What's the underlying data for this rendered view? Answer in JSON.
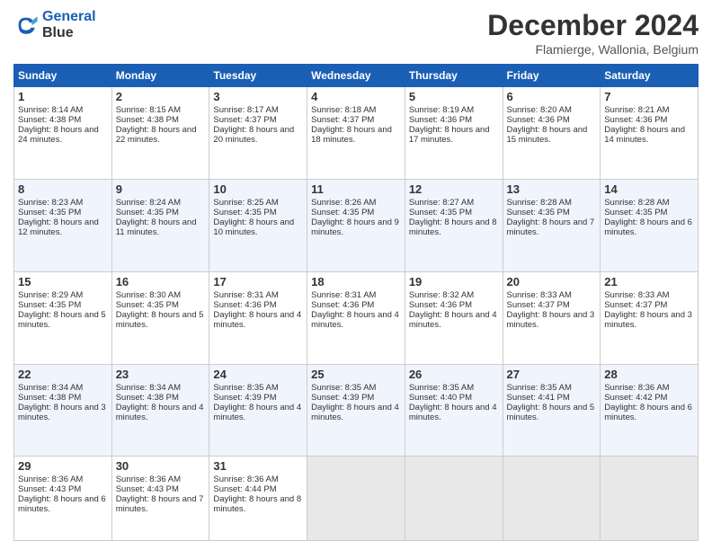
{
  "header": {
    "logo_line1": "General",
    "logo_line2": "Blue",
    "month": "December 2024",
    "location": "Flamierge, Wallonia, Belgium"
  },
  "weekdays": [
    "Sunday",
    "Monday",
    "Tuesday",
    "Wednesday",
    "Thursday",
    "Friday",
    "Saturday"
  ],
  "weeks": [
    [
      {
        "day": "1",
        "sunrise": "8:14 AM",
        "sunset": "4:38 PM",
        "daylight": "8 hours and 24 minutes."
      },
      {
        "day": "2",
        "sunrise": "8:15 AM",
        "sunset": "4:38 PM",
        "daylight": "8 hours and 22 minutes."
      },
      {
        "day": "3",
        "sunrise": "8:17 AM",
        "sunset": "4:37 PM",
        "daylight": "8 hours and 20 minutes."
      },
      {
        "day": "4",
        "sunrise": "8:18 AM",
        "sunset": "4:37 PM",
        "daylight": "8 hours and 18 minutes."
      },
      {
        "day": "5",
        "sunrise": "8:19 AM",
        "sunset": "4:36 PM",
        "daylight": "8 hours and 17 minutes."
      },
      {
        "day": "6",
        "sunrise": "8:20 AM",
        "sunset": "4:36 PM",
        "daylight": "8 hours and 15 minutes."
      },
      {
        "day": "7",
        "sunrise": "8:21 AM",
        "sunset": "4:36 PM",
        "daylight": "8 hours and 14 minutes."
      }
    ],
    [
      {
        "day": "8",
        "sunrise": "8:23 AM",
        "sunset": "4:35 PM",
        "daylight": "8 hours and 12 minutes."
      },
      {
        "day": "9",
        "sunrise": "8:24 AM",
        "sunset": "4:35 PM",
        "daylight": "8 hours and 11 minutes."
      },
      {
        "day": "10",
        "sunrise": "8:25 AM",
        "sunset": "4:35 PM",
        "daylight": "8 hours and 10 minutes."
      },
      {
        "day": "11",
        "sunrise": "8:26 AM",
        "sunset": "4:35 PM",
        "daylight": "8 hours and 9 minutes."
      },
      {
        "day": "12",
        "sunrise": "8:27 AM",
        "sunset": "4:35 PM",
        "daylight": "8 hours and 8 minutes."
      },
      {
        "day": "13",
        "sunrise": "8:28 AM",
        "sunset": "4:35 PM",
        "daylight": "8 hours and 7 minutes."
      },
      {
        "day": "14",
        "sunrise": "8:28 AM",
        "sunset": "4:35 PM",
        "daylight": "8 hours and 6 minutes."
      }
    ],
    [
      {
        "day": "15",
        "sunrise": "8:29 AM",
        "sunset": "4:35 PM",
        "daylight": "8 hours and 5 minutes."
      },
      {
        "day": "16",
        "sunrise": "8:30 AM",
        "sunset": "4:35 PM",
        "daylight": "8 hours and 5 minutes."
      },
      {
        "day": "17",
        "sunrise": "8:31 AM",
        "sunset": "4:36 PM",
        "daylight": "8 hours and 4 minutes."
      },
      {
        "day": "18",
        "sunrise": "8:31 AM",
        "sunset": "4:36 PM",
        "daylight": "8 hours and 4 minutes."
      },
      {
        "day": "19",
        "sunrise": "8:32 AM",
        "sunset": "4:36 PM",
        "daylight": "8 hours and 4 minutes."
      },
      {
        "day": "20",
        "sunrise": "8:33 AM",
        "sunset": "4:37 PM",
        "daylight": "8 hours and 3 minutes."
      },
      {
        "day": "21",
        "sunrise": "8:33 AM",
        "sunset": "4:37 PM",
        "daylight": "8 hours and 3 minutes."
      }
    ],
    [
      {
        "day": "22",
        "sunrise": "8:34 AM",
        "sunset": "4:38 PM",
        "daylight": "8 hours and 3 minutes."
      },
      {
        "day": "23",
        "sunrise": "8:34 AM",
        "sunset": "4:38 PM",
        "daylight": "8 hours and 4 minutes."
      },
      {
        "day": "24",
        "sunrise": "8:35 AM",
        "sunset": "4:39 PM",
        "daylight": "8 hours and 4 minutes."
      },
      {
        "day": "25",
        "sunrise": "8:35 AM",
        "sunset": "4:39 PM",
        "daylight": "8 hours and 4 minutes."
      },
      {
        "day": "26",
        "sunrise": "8:35 AM",
        "sunset": "4:40 PM",
        "daylight": "8 hours and 4 minutes."
      },
      {
        "day": "27",
        "sunrise": "8:35 AM",
        "sunset": "4:41 PM",
        "daylight": "8 hours and 5 minutes."
      },
      {
        "day": "28",
        "sunrise": "8:36 AM",
        "sunset": "4:42 PM",
        "daylight": "8 hours and 6 minutes."
      }
    ],
    [
      {
        "day": "29",
        "sunrise": "8:36 AM",
        "sunset": "4:43 PM",
        "daylight": "8 hours and 6 minutes."
      },
      {
        "day": "30",
        "sunrise": "8:36 AM",
        "sunset": "4:43 PM",
        "daylight": "8 hours and 7 minutes."
      },
      {
        "day": "31",
        "sunrise": "8:36 AM",
        "sunset": "4:44 PM",
        "daylight": "8 hours and 8 minutes."
      },
      null,
      null,
      null,
      null
    ]
  ]
}
